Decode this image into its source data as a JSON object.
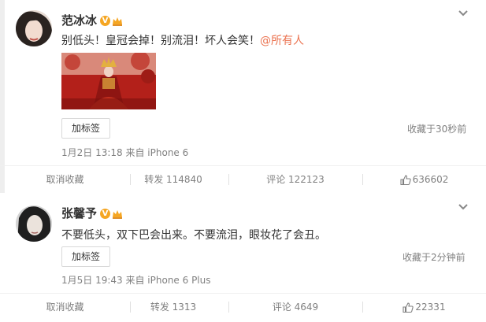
{
  "posts": [
    {
      "author": "范冰冰",
      "text": "别低头！皇冠会掉！别流泪！坏人会笑！",
      "mention": "@所有人",
      "tag_button": "加标签",
      "saved": "收藏于30秒前",
      "meta": "1月2日 13:18 来自 iPhone 6",
      "actions": {
        "unfavorite": "取消收藏",
        "repost": "转发 114840",
        "comment": "评论 122123",
        "like": "636602"
      }
    },
    {
      "author": "张馨予",
      "text": "不要低头，双下巴会出来。不要流泪，眼妆花了会丑。",
      "tag_button": "加标签",
      "saved": "收藏于2分钟前",
      "meta": "1月5日 19:43 来自 iPhone 6 Plus",
      "actions": {
        "unfavorite": "取消收藏",
        "repost": "转发 1313",
        "comment": "评论 4649",
        "like": "22331"
      }
    }
  ],
  "colors": {
    "mention": "#eb7350",
    "verified_badge": "#f5a623",
    "meta_gray": "#808080",
    "photo_red": "#b3201a"
  },
  "icons": [
    "verified-icon",
    "crown-icon",
    "chevron-down-icon",
    "thumbs-up-icon"
  ]
}
